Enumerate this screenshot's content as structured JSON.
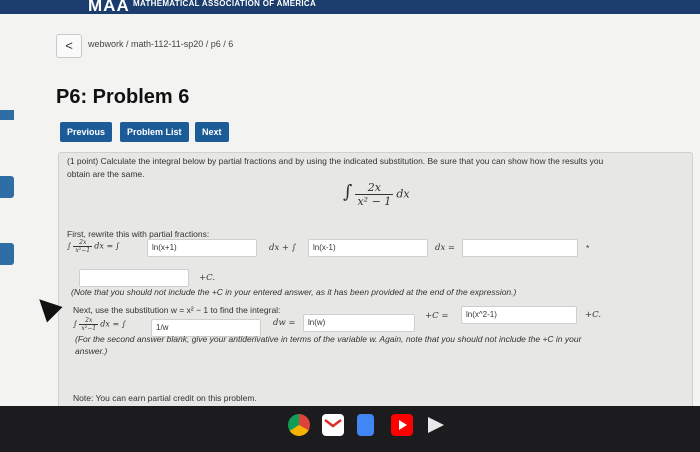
{
  "header": {
    "logo": "MAA",
    "org": "MATHEMATICAL ASSOCIATION OF AMERICA"
  },
  "nav": {
    "back_symbol": "<",
    "breadcrumb": "webwork / math-112-11-sp20 / p6 / 6"
  },
  "page_title": "P6: Problem 6",
  "buttons": {
    "previous": "Previous",
    "problem_list": "Problem List",
    "next": "Next"
  },
  "problem": {
    "intro": "(1 point) Calculate the integral below by partial fractions and by using the indicated substitution. Be sure that you can show how the results you",
    "intro2": "obtain are the same.",
    "integral": {
      "numerator": "2x",
      "denominator": "x² − 1",
      "dx": "dx"
    },
    "part1_label": "First, rewrite this with partial fractions:",
    "part1": {
      "lhs_num": "2x",
      "lhs_den": "x²−1",
      "lhs_dx": "dx =",
      "int1": "∫",
      "int2": "∫",
      "input1": "ln(x+1)",
      "input2": "ln(x-1)",
      "mid": "dx + ∫",
      "eq": "dx =",
      "input3": "",
      "input4": "",
      "plus_c": "+C.",
      "star": "*"
    },
    "note1": "(Note that you should not include the +C in your entered answer, as it has been provided at the end of the expression.)",
    "part2_label": "Next, use the substitution w = x² − 1 to find the integral:",
    "part2": {
      "lhs_num": "2x",
      "lhs_den": "x²−1",
      "eq": "dx = ∫",
      "input1": "1/w",
      "dw": "dw =",
      "input2": "ln(w)",
      "plus_c": "+C =",
      "input3": "ln(x^2-1)",
      "plus_c2": "+C."
    },
    "note2": "(For the second answer blank, give your antiderivative in terms of the variable w. Again, note that you should not include the +C in your",
    "note2b": "answer.)",
    "note3": "Note: You can earn partial credit on this problem."
  },
  "taskbar": {
    "icons": [
      "chrome-icon",
      "gmail-icon",
      "docs-icon",
      "youtube-icon",
      "play-icon"
    ]
  }
}
